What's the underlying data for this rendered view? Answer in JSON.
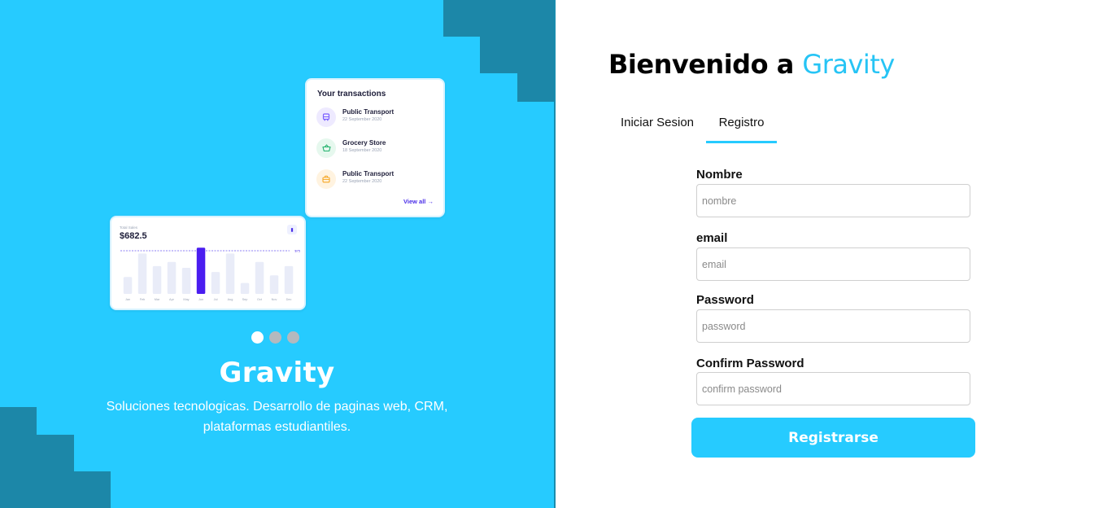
{
  "hero": {
    "brand": "Gravity",
    "tagline": "Soluciones tecnologicas. Desarrollo de paginas web, CRM, plataformas estudiantiles.",
    "carousel": {
      "count": 3,
      "active_index": 0
    },
    "transactions_card": {
      "title": "Your transactions",
      "items": [
        {
          "name": "Public Transport",
          "date": "22 September 2020",
          "icon": "bus-icon",
          "icon_color": "#7b61ff",
          "icon_bg": "#eeeaff"
        },
        {
          "name": "Grocery Store",
          "date": "18 September 2020",
          "icon": "basket-icon",
          "icon_color": "#23b26d",
          "icon_bg": "#e6f8ee"
        },
        {
          "name": "Public Transport",
          "date": "22 September 2020",
          "icon": "briefcase-icon",
          "icon_color": "#f5a623",
          "icon_bg": "#fff3e0"
        }
      ],
      "view_all": "View all"
    },
    "sales_card": {
      "label": "Total Sales",
      "value": "$682.5",
      "chart_data": {
        "type": "bar",
        "categories": [
          "Jan",
          "Feb",
          "Mar",
          "Apr",
          "May",
          "Jun",
          "Jul",
          "Aug",
          "Sep",
          "Oct",
          "Nov",
          "Dec"
        ],
        "values": [
          20,
          48,
          33,
          38,
          31,
          55,
          26,
          48,
          13,
          38,
          22,
          33
        ],
        "highlight_index": 5,
        "reference_label": "$75",
        "ylim": [
          0,
          60
        ]
      }
    }
  },
  "form": {
    "welcome_prefix": "Bienvenido a",
    "welcome_brand": "Gravity",
    "tabs": {
      "login": "Iniciar Sesion",
      "register": "Registro",
      "active": "register"
    },
    "fields": {
      "name": {
        "label": "Nombre",
        "placeholder": "nombre"
      },
      "email": {
        "label": "email",
        "placeholder": "email"
      },
      "password": {
        "label": "Password",
        "placeholder": "password"
      },
      "confirm": {
        "label": "Confirm Password",
        "placeholder": "confirm password"
      }
    },
    "submit": "Registrarse"
  },
  "colors": {
    "panel": "#26cbff",
    "step": "#1c87a8",
    "accent": "#26c4f5",
    "bar_highlight": "#4a1df0",
    "bar": "#e9ecf8"
  }
}
